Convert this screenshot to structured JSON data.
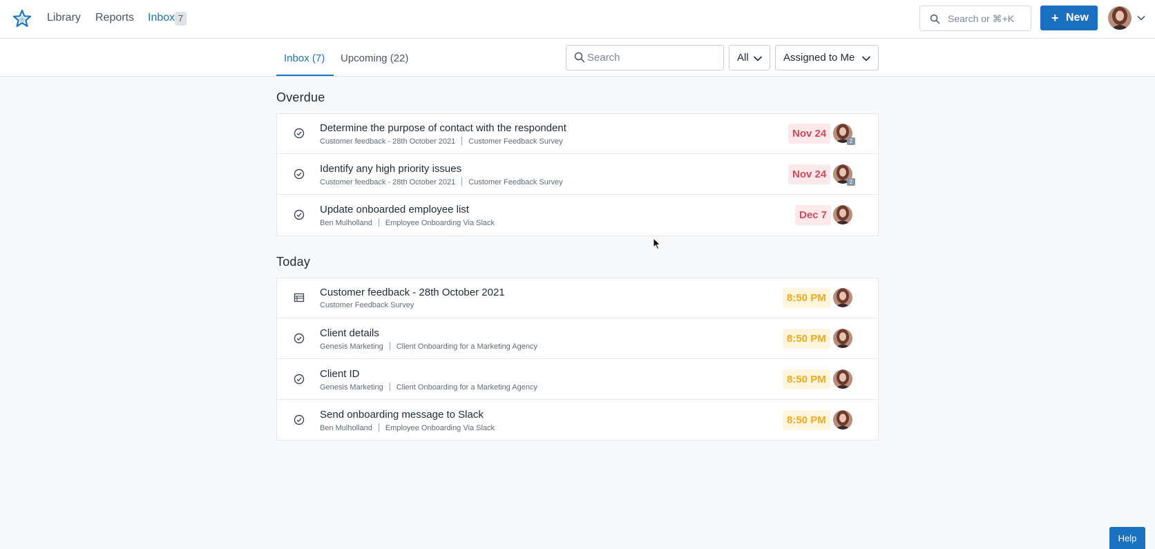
{
  "nav": {
    "library": "Library",
    "reports": "Reports",
    "inbox": "Inbox",
    "inbox_count": "7",
    "search_placeholder": "Search or ⌘+K",
    "new_label": "New",
    "help_label": "Help"
  },
  "tabs": [
    {
      "label": "Inbox (7)",
      "active": true
    },
    {
      "label": "Upcoming (22)",
      "active": false
    }
  ],
  "filters": {
    "search_placeholder": "Search",
    "type_filter": "All",
    "assignee_filter": "Assigned to Me"
  },
  "sections": {
    "overdue": {
      "title": "Overdue",
      "items": [
        {
          "icon": "check-circle-icon",
          "title": "Determine the purpose of contact with the respondent",
          "parent": "Customer feedback - 28th October 2021",
          "workflow": "Customer Feedback Survey",
          "due": "Nov 24",
          "assignee_count": "2"
        },
        {
          "icon": "check-circle-icon",
          "title": "Identify any high priority issues",
          "parent": "Customer feedback - 28th October 2021",
          "workflow": "Customer Feedback Survey",
          "due": "Nov 24",
          "assignee_count": "2"
        },
        {
          "icon": "check-circle-icon",
          "title": "Update onboarded employee list",
          "parent": "Ben Mulholland",
          "workflow": "Employee Onboarding Via Slack",
          "due": "Dec 7",
          "assignee_count": ""
        }
      ]
    },
    "today": {
      "title": "Today",
      "items": [
        {
          "icon": "table-icon",
          "title": "Customer feedback - 28th October 2021",
          "parent": "Customer Feedback Survey",
          "workflow": "",
          "due": "8:50 PM"
        },
        {
          "icon": "check-circle-icon",
          "title": "Client details",
          "parent": "Genesis Marketing",
          "workflow": "Client Onboarding for a Marketing Agency",
          "due": "8:50 PM"
        },
        {
          "icon": "check-circle-icon",
          "title": "Client ID",
          "parent": "Genesis Marketing",
          "workflow": "Client Onboarding for a Marketing Agency",
          "due": "8:50 PM"
        },
        {
          "icon": "check-circle-icon",
          "title": "Send onboarding message to Slack",
          "parent": "Ben Mulholland",
          "workflow": "Employee Onboarding Via Slack",
          "due": "8:50 PM"
        }
      ]
    }
  },
  "colors": {
    "accent": "#1a73c0",
    "overdue": "#d8475c",
    "today": "#f0a81e"
  }
}
